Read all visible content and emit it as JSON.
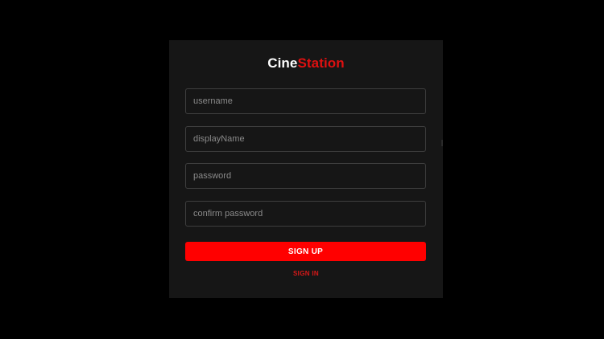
{
  "brand": {
    "name_part1": "Cine",
    "name_part2": "Station",
    "colors": {
      "background": "#000000",
      "card": "#161616",
      "accent": "#ff0000",
      "accent_text": "#e01010",
      "field_border": "#3e3e3e"
    }
  },
  "form": {
    "username_placeholder": "username",
    "display_name_placeholder": "displayName",
    "password_placeholder": "password",
    "confirm_password_placeholder": "confirm password",
    "username_value": "",
    "display_name_value": "",
    "password_value": "",
    "confirm_password_value": ""
  },
  "actions": {
    "sign_up_label": "SIGN UP",
    "sign_in_label": "SIGN IN"
  }
}
